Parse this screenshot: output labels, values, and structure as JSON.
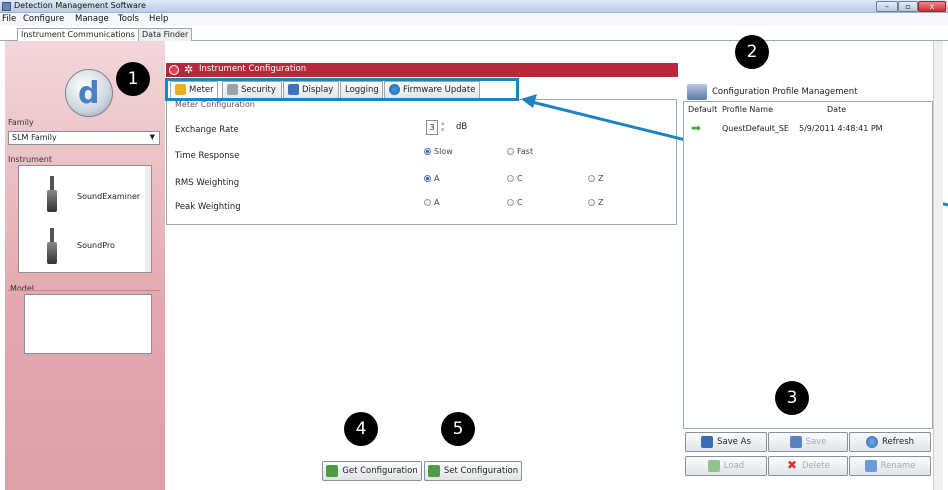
{
  "window": {
    "title": "Detection Management Software",
    "min": "–",
    "max": "▫",
    "close": "x"
  },
  "menu": [
    "File",
    "Configure",
    "Manage",
    "Tools",
    "Help"
  ],
  "app_tabs": [
    "Instrument Communications",
    "Data Finder"
  ],
  "left": {
    "logo_letter": "d",
    "family_label": "Family",
    "family_value": "SLM Family",
    "instrument_label": "Instrument",
    "instruments": [
      "SoundExaminer",
      "SoundPro"
    ],
    "model_label": "Model"
  },
  "instrument_config": {
    "title": "Instrument Configuration",
    "tabs": [
      "Meter",
      "Security",
      "Display",
      "Logging",
      "Firmware Update"
    ],
    "group_title": "Meter Configuration",
    "exchange_rate": {
      "label": "Exchange Rate",
      "value": "3",
      "unit": "dB"
    },
    "time_response": {
      "label": "Time Response",
      "options": [
        "Slow",
        "Fast"
      ],
      "selected": "Slow"
    },
    "rms_weighting": {
      "label": "RMS Weighting",
      "options": [
        "A",
        "C",
        "Z"
      ],
      "selected": "A"
    },
    "peak_weighting": {
      "label": "Peak Weighting",
      "options": [
        "A",
        "C",
        "Z"
      ],
      "selected": ""
    }
  },
  "profile_mgmt": {
    "title": "Configuration Profile Management",
    "columns": [
      "Default",
      "Profile Name",
      "Date"
    ],
    "rows": [
      {
        "name": "QuestDefault_SE",
        "date": "5/9/2011 4:48:41 PM"
      }
    ],
    "buttons": [
      "Save As",
      "Save",
      "Refresh",
      "Load",
      "Delete",
      "Rename"
    ]
  },
  "bottom_buttons": [
    "Get Configuration",
    "Set Configuration"
  ],
  "callouts": [
    "1",
    "2",
    "3",
    "4",
    "5"
  ],
  "colors": {
    "header_red": "#b8283a",
    "callout_blue": "#1e82c3",
    "panel_pink": "#e3a7ad"
  }
}
